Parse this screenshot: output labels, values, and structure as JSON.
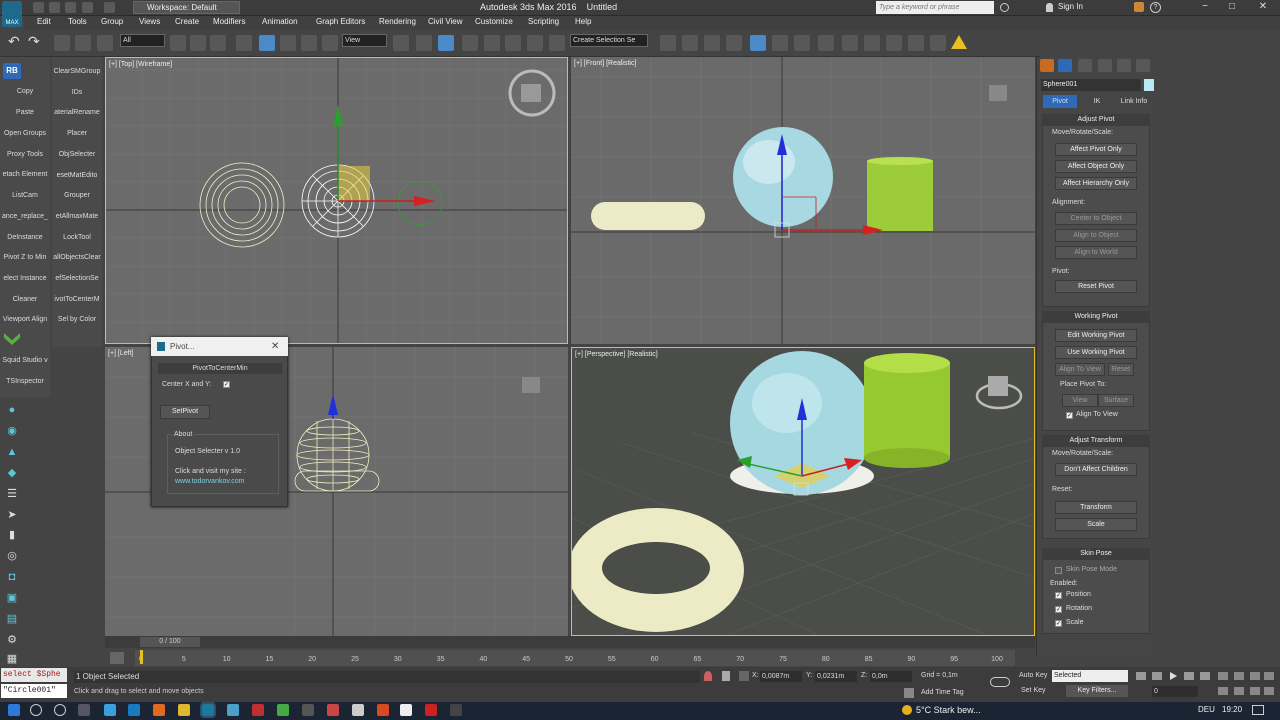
{
  "app": {
    "title": "Autodesk 3ds Max 2016",
    "document": "Untitled",
    "workspace": "Workspace: Default",
    "search_placeholder": "Type a keyword or phrase",
    "sign_in": "Sign In",
    "icon_label": "MAX"
  },
  "menu": [
    "Edit",
    "Tools",
    "Group",
    "Views",
    "Create",
    "Modifiers",
    "Animation",
    "Graph Editors",
    "Rendering",
    "Civil View",
    "Customize",
    "Scripting",
    "Help"
  ],
  "toolbar": {
    "selection_filter": "All",
    "ref_coord": "View",
    "named_selection": "Create Selection Se"
  },
  "scripts_left": [
    "Copy",
    "Paste",
    "Open Groups",
    "Proxy Tools",
    "etach Element",
    "ListCam",
    "ance_replace_",
    "DeInstance",
    "Pivot Z to Min",
    "elect Instance",
    "Cleaner",
    "Viewport Align",
    "Squid Studio v",
    "TSInspector"
  ],
  "scripts_right": [
    "ClearSMGroup",
    "IDs",
    "aterialRename",
    "Placer",
    "ObjSelecter",
    "esetMatEdito",
    "Grouper",
    "etAllmaxMate",
    "LockTool",
    "allObjectsClear",
    "efSelectionSe",
    "ivotToCenterM",
    "Sel by Color"
  ],
  "rb_label": "RB",
  "viewports": {
    "top": "[+] [Top] [Wireframe]",
    "front": "[+] [Front] [Realistic]",
    "left": "[+] [Left]",
    "perspective": "[+] [Perspective] [Realistic]"
  },
  "dialog": {
    "title": "Pivot...",
    "rollout": "PivotToCenterMin",
    "center_label": "Center X and Y:",
    "set_pivot": "SetPivot",
    "about": "About",
    "version": "Object Selecter v 1.0",
    "visit": "Click and visit my site :",
    "site": "www.todorvankov.com"
  },
  "command_panel": {
    "object_name": "Sphere001",
    "object_color": "#b8e8f0",
    "tabs": [
      "Pivot",
      "IK",
      "Link Info"
    ],
    "adjust_pivot": {
      "header": "Adjust Pivot",
      "move_label": "Move/Rotate/Scale:",
      "buttons": [
        "Affect Pivot Only",
        "Affect Object Only",
        "Affect Hierarchy Only"
      ],
      "alignment_label": "Alignment:",
      "align_buttons": [
        "Center to Object",
        "Align to Object",
        "Align to World"
      ],
      "pivot_label": "Pivot:",
      "reset_pivot": "Reset Pivot"
    },
    "working_pivot": {
      "header": "Working Pivot",
      "buttons": [
        "Edit Working Pivot",
        "Use Working Pivot"
      ],
      "align_to_view": "Align To View",
      "reset": "Reset",
      "place_label": "Place Pivot To:",
      "view": "View",
      "surface": "Surface",
      "align_check": "Align To View"
    },
    "adjust_transform": {
      "header": "Adjust Transform",
      "move_label": "Move/Rotate/Scale:",
      "dont_affect": "Don't Affect Children",
      "reset_label": "Reset:",
      "transform": "Transform",
      "scale": "Scale"
    },
    "skin_pose": {
      "header": "Skin Pose",
      "mode": "Skin Pose Mode",
      "enabled": "Enabled:",
      "position": "Position",
      "rotation": "Rotation",
      "scale": "Scale"
    }
  },
  "timeline": {
    "frame": "0 / 100",
    "ticks": [
      "0",
      "5",
      "10",
      "15",
      "20",
      "25",
      "30",
      "35",
      "40",
      "45",
      "50",
      "55",
      "60",
      "65",
      "70",
      "75",
      "80",
      "85",
      "90",
      "95",
      "100"
    ]
  },
  "status": {
    "maxscript1": "select $Sphe",
    "maxscript2": "\"Circle001\"",
    "selected": "1 Object Selected",
    "prompt": "Click and drag to select and move objects",
    "x_label": "X:",
    "x": "0,0087m",
    "y_label": "Y:",
    "y": "0,0231m",
    "z_label": "Z:",
    "z": "0,0m",
    "grid": "Grid = 0,1m",
    "add_time_tag": "Add Time Tag",
    "auto_key": "Auto Key",
    "set_key": "Set Key",
    "key_mode": "Selected",
    "key_filters": "Key Filters...",
    "frame_field": "0"
  },
  "taskbar": {
    "weather": "5°C  Stark bew...",
    "lang": "DEU",
    "time": "19:20"
  }
}
